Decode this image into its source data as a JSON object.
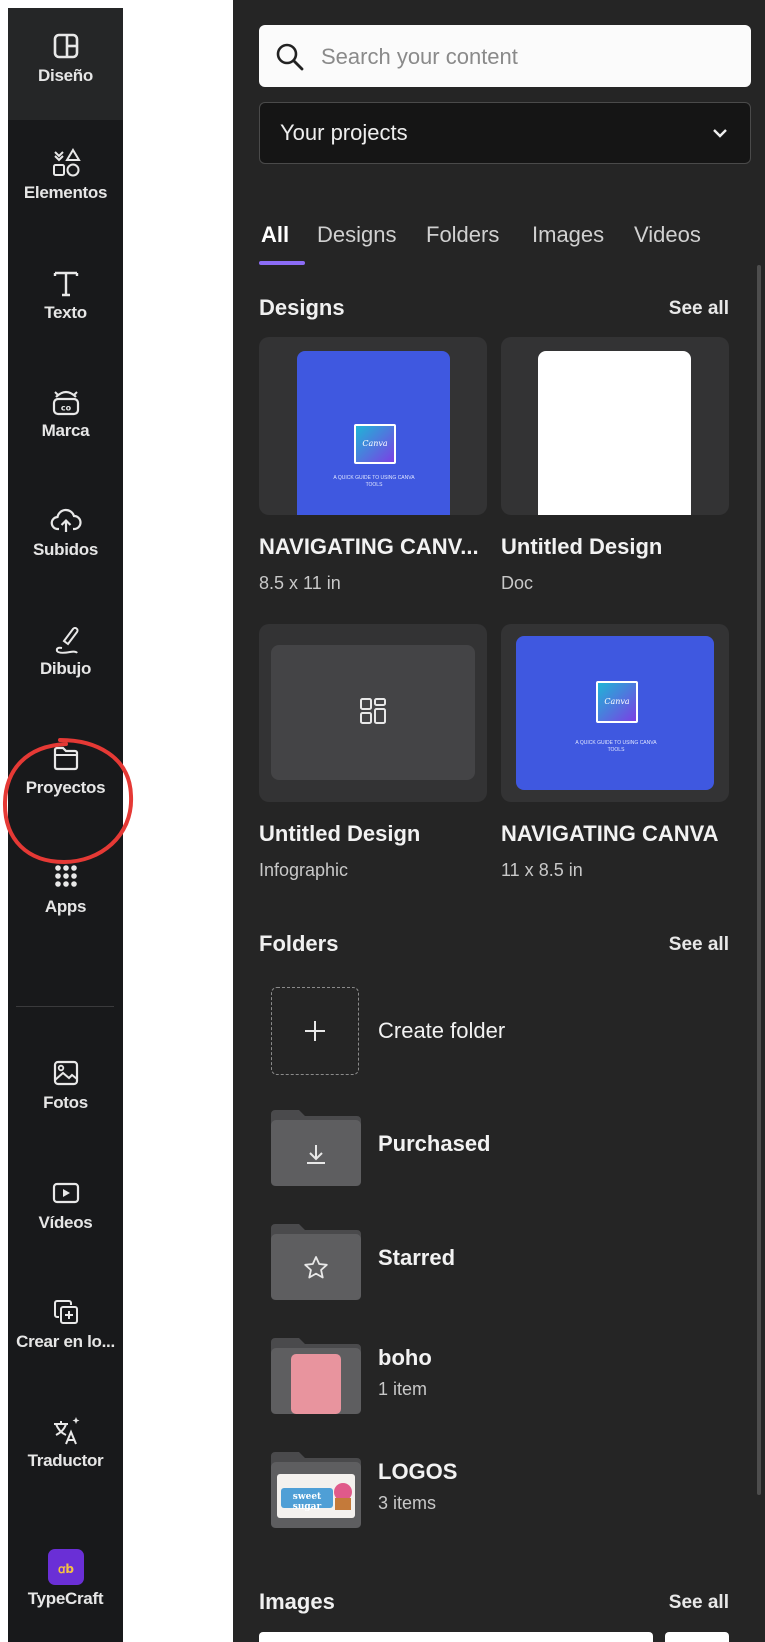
{
  "rail": {
    "items": [
      {
        "label": "Diseño",
        "icon": "layout-icon"
      },
      {
        "label": "Elementos",
        "icon": "shapes-icon"
      },
      {
        "label": "Texto",
        "icon": "text-icon"
      },
      {
        "label": "Marca",
        "icon": "brand-icon"
      },
      {
        "label": "Subidos",
        "icon": "cloud-upload-icon"
      },
      {
        "label": "Dibujo",
        "icon": "draw-icon"
      },
      {
        "label": "Proyectos",
        "icon": "folder-icon"
      },
      {
        "label": "Apps",
        "icon": "apps-grid-icon"
      },
      {
        "label": "Fotos",
        "icon": "photo-icon"
      },
      {
        "label": "Vídeos",
        "icon": "video-icon"
      },
      {
        "label": "Crear en lo...",
        "icon": "create-in-bulk-icon"
      },
      {
        "label": "Traductor",
        "icon": "translate-icon"
      },
      {
        "label": "TypeCraft",
        "icon": "typecraft-app-icon"
      }
    ],
    "active_item": "Diseño",
    "annotation_color": "#e53935"
  },
  "search": {
    "placeholder": "Search your content"
  },
  "projects_select": {
    "value": "Your projects"
  },
  "tabs": [
    "All",
    "Designs",
    "Folders",
    "Images",
    "Videos"
  ],
  "active_tab": "All",
  "accent": "#8b6cf6",
  "designs": {
    "title": "Designs",
    "see_all": "See all",
    "items": [
      {
        "name": "NAVIGATING CANV...",
        "meta": "8.5 x 11 in",
        "thumb_logo": "Canva",
        "thumb_caption": "A QUICK GUIDE TO USING CANVA TOOLS"
      },
      {
        "name": "Untitled Design",
        "meta": "Doc"
      },
      {
        "name": "Untitled Design",
        "meta": "Infographic"
      },
      {
        "name": "NAVIGATING CANVA",
        "meta": "11 x 8.5 in",
        "thumb_logo": "Canva",
        "thumb_caption": "A QUICK GUIDE TO USING CANVA TOOLS"
      }
    ]
  },
  "folders": {
    "title": "Folders",
    "see_all": "See all",
    "create": "Create folder",
    "items": [
      {
        "name": "Purchased",
        "meta": "",
        "icon": "download-icon"
      },
      {
        "name": "Starred",
        "meta": "",
        "icon": "star-icon"
      },
      {
        "name": "boho",
        "meta": "1 item"
      },
      {
        "name": "LOGOS",
        "meta": "3 items",
        "thumb_text": "sweet sugar"
      }
    ]
  },
  "images": {
    "title": "Images",
    "see_all": "See all"
  }
}
